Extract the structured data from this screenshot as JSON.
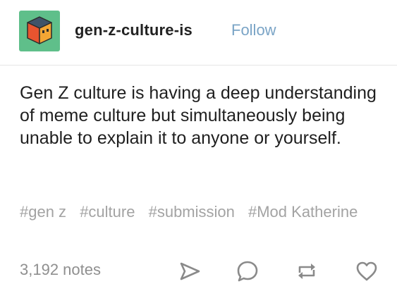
{
  "post": {
    "blog_name": "gen-z-culture-is",
    "follow_label": "Follow",
    "avatar_icon": "cube-face-icon",
    "body_text": "Gen Z culture is having a deep understanding of meme culture but simultaneously being unable to explain it to anyone or yourself.",
    "tags": [
      "#gen z",
      "#culture",
      "#submission",
      "#Mod Katherine"
    ],
    "notes_count": "3,192 notes",
    "actions": [
      "share-icon",
      "reply-icon",
      "reblog-icon",
      "like-icon"
    ]
  },
  "colors": {
    "accent": "#7aa4c6",
    "avatar_bg": "#5fbf8a",
    "tag_text": "#a3a3a3",
    "notes_text": "#8f8f8f"
  }
}
